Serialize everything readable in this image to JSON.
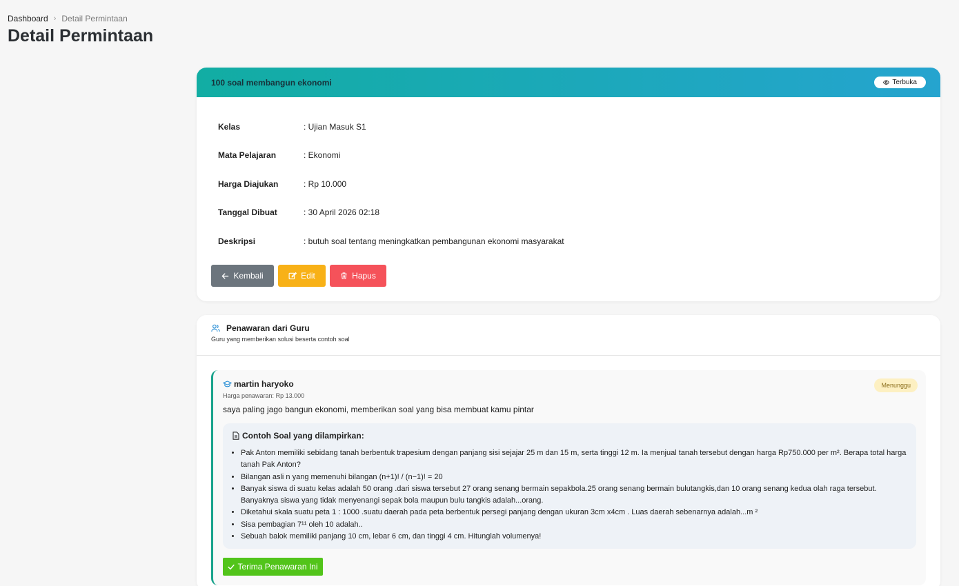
{
  "breadcrumb": {
    "home": "Dashboard",
    "separator": "›",
    "current": "Detail Permintaan"
  },
  "page_title": "Detail Permintaan",
  "request": {
    "title": "100 soal membangun ekonomi",
    "status_label": "Terbuka",
    "fields": [
      {
        "label": "Kelas",
        "value": ": Ujian Masuk S1"
      },
      {
        "label": "Mata Pelajaran",
        "value": ": Ekonomi"
      },
      {
        "label": "Harga Diajukan",
        "value": ": Rp 10.000"
      },
      {
        "label": "Tanggal Dibuat",
        "value": ": 30 April 2026 02:18"
      },
      {
        "label": "Deskripsi",
        "value": ": butuh soal tentang meningkatkan pembangunan ekonomi masyarakat"
      }
    ],
    "buttons": {
      "back": "Kembali",
      "edit": "Edit",
      "delete": "Hapus"
    }
  },
  "offers_section": {
    "title": "Penawaran dari Guru",
    "subtitle": "Guru yang memberikan solusi beserta contoh soal"
  },
  "offer": {
    "teacher_name": "martin haryoko",
    "price_label": "Harga penawaran:",
    "price_value": "Rp 13.000",
    "status": "Menunggu",
    "message": "saya paling jago bangun ekonomi, memberikan soal yang bisa membuat kamu pintar",
    "samples_title": "Contoh Soal yang dilampirkan:",
    "samples": [
      "Pak Anton memiliki sebidang tanah berbentuk trapesium dengan panjang sisi sejajar 25 m dan 15 m, serta tinggi 12 m. Ia menjual tanah tersebut dengan harga Rp750.000 per m². Berapa total harga tanah Pak Anton?",
      "Bilangan asli n yang memenuhi bilangan (n+1)! / (n−1)! = 20",
      "Banyak siswa di suatu kelas adalah 50 orang .dari siswa tersebut 27 orang senang bermain sepakbola.25 orang senang bermain bulutangkis,dan 10 orang senang kedua olah raga tersebut. Banyaknya siswa yang tidak menyenangi sepak bola maupun bulu tangkis adalah...orang.",
      "Diketahui skala suatu peta 1 : 1000 .suatu daerah pada peta berbentuk persegi panjang dengan ukuran 3cm x4cm . Luas daerah sebenarnya adalah...m ²",
      "Sisa pembagian 7¹¹ oleh 10 adalah..",
      "Sebuah balok memiliki panjang 10 cm, lebar 6 cm, dan tinggi 4 cm. Hitunglah volumenya!"
    ],
    "accept_label": "Terima Penawaran Ini"
  },
  "colors": {
    "header_gradient_start": "#12ada3",
    "header_gradient_end": "#25a4cf",
    "back_button": "#6c757d",
    "edit_button": "#f8b117",
    "delete_button": "#f5525a",
    "accept_button": "#52c41a",
    "offer_accent": "#19a38c"
  }
}
